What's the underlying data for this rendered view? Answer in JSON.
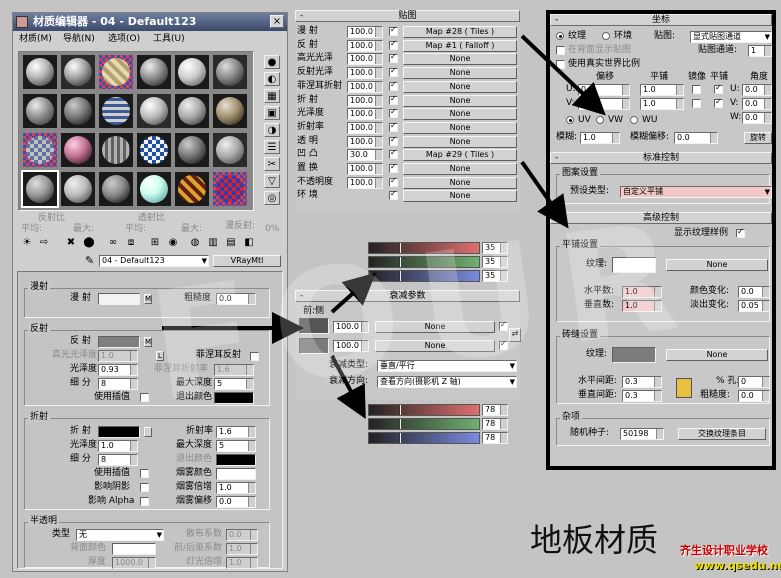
{
  "window": {
    "title": "材质编辑器 - 04 - Default123",
    "menus": [
      "材质(M)",
      "导航(N)",
      "选项(O)",
      "工具(U)"
    ],
    "close_glyph": "×"
  },
  "side_tools": [
    "●",
    "◐",
    "▦",
    "▣",
    "◑",
    "☰",
    "✂",
    "▽",
    "◎",
    "✓"
  ],
  "params_bar": {
    "reflect_label": "反射比",
    "reflect_avg": "平均:",
    "reflect_max": "最大:",
    "trans_label": "透射比",
    "trans_avg": "平均:",
    "trans_max": "最大:",
    "diffuse_label": "漫反射:",
    "diffuse_val": "0%"
  },
  "toolbar_icons": [
    "☀",
    "⇨",
    "✖",
    "⬤",
    "∞",
    "⧈",
    "⊞",
    "◉",
    "◍",
    "▥",
    "▤",
    "◧"
  ],
  "material_name": "04 - Default123",
  "material_type": "VRayMtl",
  "pick_icon": "✎",
  "diffuse": {
    "section": "漫射",
    "diffuse_label": "漫 射",
    "m_btn": "M",
    "roughness_label": "粗糙度",
    "roughness_val": "0.0"
  },
  "reflection": {
    "section": "反射",
    "reflect_label": "反 射",
    "m_btn": "M",
    "hilight_label": "高光光泽度",
    "hilight_val": "1.0",
    "l_btn": "L",
    "fresnel_label": "菲涅耳反射",
    "gloss_label": "光泽度",
    "gloss_val": "0.93",
    "fresnel_ior_label": "菲涅耳折射率",
    "fresnel_ior_val": "1.6",
    "subdiv_label": "细 分",
    "subdiv_val": "8",
    "max_depth_label": "最大深度",
    "max_depth_val": "5",
    "interp_label": "使用插值",
    "exit_color_label": "退出颜色"
  },
  "refraction": {
    "section": "折射",
    "refract_label": "折 射",
    "ior_label": "折射率",
    "ior_val": "1.6",
    "gloss_label": "光泽度",
    "gloss_val": "1.0",
    "max_depth_label": "最大深度",
    "max_depth_val": "5",
    "subdiv_label": "细 分",
    "subdiv_val": "8",
    "exit_label": "退出颜色",
    "interp_label": "使用插值",
    "fog_color_label": "烟雾颜色",
    "shadow_label": "影响阴影",
    "fog_mult_label": "烟雾倍增",
    "fog_mult_val": "1.0",
    "alpha_label": "影响 Alpha",
    "fog_bias_label": "烟雾偏移",
    "fog_bias_val": "0.0"
  },
  "translucency": {
    "section": "半透明",
    "type_label": "类型",
    "type_val": "无",
    "scatter_label": "散布系数",
    "scatter_val": "0.0",
    "back_label": "背面颜色",
    "fb_label": "前/后驱系数",
    "fb_val": "1.0",
    "thick_label": "厚度",
    "thick_val": "1000.0",
    "light_label": "灯光倍增",
    "light_val": "1.0"
  },
  "maps": {
    "title": "贴图",
    "sign": "-",
    "rows": [
      {
        "label": "漫 射",
        "amount": "100.0",
        "on": true,
        "map": "Map #28  ( Tiles )"
      },
      {
        "label": "反 射",
        "amount": "100.0",
        "on": true,
        "map": "Map #1  ( Falloff )"
      },
      {
        "label": "高光光泽",
        "amount": "100.0",
        "on": true,
        "map": "None"
      },
      {
        "label": "反射光泽",
        "amount": "100.0",
        "on": true,
        "map": "None"
      },
      {
        "label": "菲涅耳折射",
        "amount": "100.0",
        "on": true,
        "map": "None"
      },
      {
        "label": "折 射",
        "amount": "100.0",
        "on": true,
        "map": "None"
      },
      {
        "label": "光泽度",
        "amount": "100.0",
        "on": true,
        "map": "None"
      },
      {
        "label": "折射率",
        "amount": "100.0",
        "on": true,
        "map": "None"
      },
      {
        "label": "透 明",
        "amount": "100.0",
        "on": true,
        "map": "None"
      },
      {
        "label": "凹 凸",
        "amount": "30.0",
        "on": true,
        "map": "Map #29  ( Tiles )"
      },
      {
        "label": "置 换",
        "amount": "100.0",
        "on": true,
        "map": "None"
      },
      {
        "label": "不透明度",
        "amount": "100.0",
        "on": true,
        "map": "None"
      },
      {
        "label": "环 境",
        "amount": "",
        "on": true,
        "map": "None"
      }
    ]
  },
  "color_curves_top": {
    "values": [
      "35",
      "35",
      "35"
    ],
    "colors": [
      "#e07070",
      "#70b070",
      "#7a8ae0"
    ]
  },
  "falloff": {
    "title": "衰减参数",
    "sign": "-",
    "front_side": "前:侧",
    "swap_icon": "⇄",
    "rows": [
      {
        "amount": "100.0",
        "map": "None"
      },
      {
        "amount": "100.0",
        "map": "None"
      }
    ],
    "type_label": "衰减类型:",
    "type_val": "垂直/平行",
    "dir_label": "衰减方向:",
    "dir_val": "查看方向(摄影机 Z 轴)"
  },
  "color_curves_bottom": {
    "values": [
      "78",
      "78",
      "78"
    ],
    "colors": [
      "#e07070",
      "#70b070",
      "#7a8ae0"
    ]
  },
  "coords": {
    "title": "坐标",
    "texture": "纹理",
    "environ": "环境",
    "map_label": "贴图:",
    "map_val": "显式贴图通道",
    "show_back": "在背面显示贴图",
    "map_channel_label": "贴图通道:",
    "map_channel_val": "1",
    "real_world": "使用真实世界比例",
    "offset": "偏移",
    "tiling": "平铺",
    "mirror": "镜像",
    "tile": "平铺",
    "angle": "角度",
    "u": "U:",
    "v": "V:",
    "w": "W:",
    "u_offset": "0.0",
    "v_offset": "0.0",
    "u_tiling": "1.0",
    "v_tiling": "1.0",
    "u_angle": "0.0",
    "v_angle": "0.0",
    "w_angle": "0.0",
    "uv": "UV",
    "vw": "VW",
    "wu": "WU",
    "blur_label": "模糊:",
    "blur_val": "1.0",
    "blur_off_label": "模糊偏移:",
    "blur_off_val": "0.0",
    "rotate": "旋转"
  },
  "std_ctrl": {
    "title": "标准控制",
    "pattern_label": "图案设置",
    "preset_label": "预设类型:",
    "preset_val": "自定义平铺"
  },
  "adv_ctrl": {
    "title": "高级控制",
    "show_tex": "显示纹理样例",
    "tiles_label": "平铺设置",
    "texture_label": "纹理:",
    "none": "None",
    "h_count_label": "水平数:",
    "h_count": "1.0",
    "v_count_label": "垂直数:",
    "v_count": "1.0",
    "color_var_label": "颜色变化:",
    "color_var": "0.0",
    "fade_var_label": "淡出变化:",
    "fade_var": "0.05",
    "grout_label": "砖缝设置",
    "grout_tex": "纹理:",
    "h_gap_label": "水平间距:",
    "h_gap": "0.3",
    "v_gap_label": "垂直间距:",
    "v_gap": "0.3",
    "holes_label": "% 孔:",
    "holes": "0",
    "rough_label": "粗糙度:",
    "rough": "0.0",
    "misc_label": "杂项",
    "seed_label": "随机种子:",
    "seed": "50198",
    "swap_btn": "交换纹理条目"
  },
  "caption": "地板材质",
  "watermark": {
    "main": "齐生设计职业学校",
    "url": "www.qsedu.net"
  },
  "overlay_text": "FOUR"
}
